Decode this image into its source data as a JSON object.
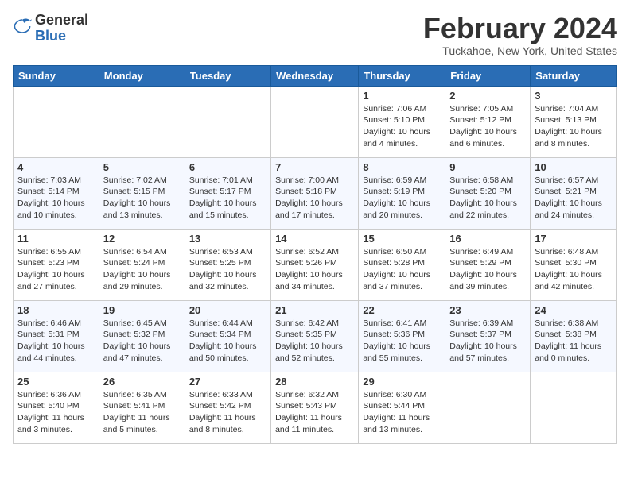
{
  "header": {
    "logo": {
      "general": "General",
      "blue": "Blue"
    },
    "month_year": "February 2024",
    "location": "Tuckahoe, New York, United States"
  },
  "weekdays": [
    "Sunday",
    "Monday",
    "Tuesday",
    "Wednesday",
    "Thursday",
    "Friday",
    "Saturday"
  ],
  "weeks": [
    [
      {
        "day": "",
        "info": ""
      },
      {
        "day": "",
        "info": ""
      },
      {
        "day": "",
        "info": ""
      },
      {
        "day": "",
        "info": ""
      },
      {
        "day": "1",
        "info": "Sunrise: 7:06 AM\nSunset: 5:10 PM\nDaylight: 10 hours\nand 4 minutes."
      },
      {
        "day": "2",
        "info": "Sunrise: 7:05 AM\nSunset: 5:12 PM\nDaylight: 10 hours\nand 6 minutes."
      },
      {
        "day": "3",
        "info": "Sunrise: 7:04 AM\nSunset: 5:13 PM\nDaylight: 10 hours\nand 8 minutes."
      }
    ],
    [
      {
        "day": "4",
        "info": "Sunrise: 7:03 AM\nSunset: 5:14 PM\nDaylight: 10 hours\nand 10 minutes."
      },
      {
        "day": "5",
        "info": "Sunrise: 7:02 AM\nSunset: 5:15 PM\nDaylight: 10 hours\nand 13 minutes."
      },
      {
        "day": "6",
        "info": "Sunrise: 7:01 AM\nSunset: 5:17 PM\nDaylight: 10 hours\nand 15 minutes."
      },
      {
        "day": "7",
        "info": "Sunrise: 7:00 AM\nSunset: 5:18 PM\nDaylight: 10 hours\nand 17 minutes."
      },
      {
        "day": "8",
        "info": "Sunrise: 6:59 AM\nSunset: 5:19 PM\nDaylight: 10 hours\nand 20 minutes."
      },
      {
        "day": "9",
        "info": "Sunrise: 6:58 AM\nSunset: 5:20 PM\nDaylight: 10 hours\nand 22 minutes."
      },
      {
        "day": "10",
        "info": "Sunrise: 6:57 AM\nSunset: 5:21 PM\nDaylight: 10 hours\nand 24 minutes."
      }
    ],
    [
      {
        "day": "11",
        "info": "Sunrise: 6:55 AM\nSunset: 5:23 PM\nDaylight: 10 hours\nand 27 minutes."
      },
      {
        "day": "12",
        "info": "Sunrise: 6:54 AM\nSunset: 5:24 PM\nDaylight: 10 hours\nand 29 minutes."
      },
      {
        "day": "13",
        "info": "Sunrise: 6:53 AM\nSunset: 5:25 PM\nDaylight: 10 hours\nand 32 minutes."
      },
      {
        "day": "14",
        "info": "Sunrise: 6:52 AM\nSunset: 5:26 PM\nDaylight: 10 hours\nand 34 minutes."
      },
      {
        "day": "15",
        "info": "Sunrise: 6:50 AM\nSunset: 5:28 PM\nDaylight: 10 hours\nand 37 minutes."
      },
      {
        "day": "16",
        "info": "Sunrise: 6:49 AM\nSunset: 5:29 PM\nDaylight: 10 hours\nand 39 minutes."
      },
      {
        "day": "17",
        "info": "Sunrise: 6:48 AM\nSunset: 5:30 PM\nDaylight: 10 hours\nand 42 minutes."
      }
    ],
    [
      {
        "day": "18",
        "info": "Sunrise: 6:46 AM\nSunset: 5:31 PM\nDaylight: 10 hours\nand 44 minutes."
      },
      {
        "day": "19",
        "info": "Sunrise: 6:45 AM\nSunset: 5:32 PM\nDaylight: 10 hours\nand 47 minutes."
      },
      {
        "day": "20",
        "info": "Sunrise: 6:44 AM\nSunset: 5:34 PM\nDaylight: 10 hours\nand 50 minutes."
      },
      {
        "day": "21",
        "info": "Sunrise: 6:42 AM\nSunset: 5:35 PM\nDaylight: 10 hours\nand 52 minutes."
      },
      {
        "day": "22",
        "info": "Sunrise: 6:41 AM\nSunset: 5:36 PM\nDaylight: 10 hours\nand 55 minutes."
      },
      {
        "day": "23",
        "info": "Sunrise: 6:39 AM\nSunset: 5:37 PM\nDaylight: 10 hours\nand 57 minutes."
      },
      {
        "day": "24",
        "info": "Sunrise: 6:38 AM\nSunset: 5:38 PM\nDaylight: 11 hours\nand 0 minutes."
      }
    ],
    [
      {
        "day": "25",
        "info": "Sunrise: 6:36 AM\nSunset: 5:40 PM\nDaylight: 11 hours\nand 3 minutes."
      },
      {
        "day": "26",
        "info": "Sunrise: 6:35 AM\nSunset: 5:41 PM\nDaylight: 11 hours\nand 5 minutes."
      },
      {
        "day": "27",
        "info": "Sunrise: 6:33 AM\nSunset: 5:42 PM\nDaylight: 11 hours\nand 8 minutes."
      },
      {
        "day": "28",
        "info": "Sunrise: 6:32 AM\nSunset: 5:43 PM\nDaylight: 11 hours\nand 11 minutes."
      },
      {
        "day": "29",
        "info": "Sunrise: 6:30 AM\nSunset: 5:44 PM\nDaylight: 11 hours\nand 13 minutes."
      },
      {
        "day": "",
        "info": ""
      },
      {
        "day": "",
        "info": ""
      }
    ]
  ]
}
